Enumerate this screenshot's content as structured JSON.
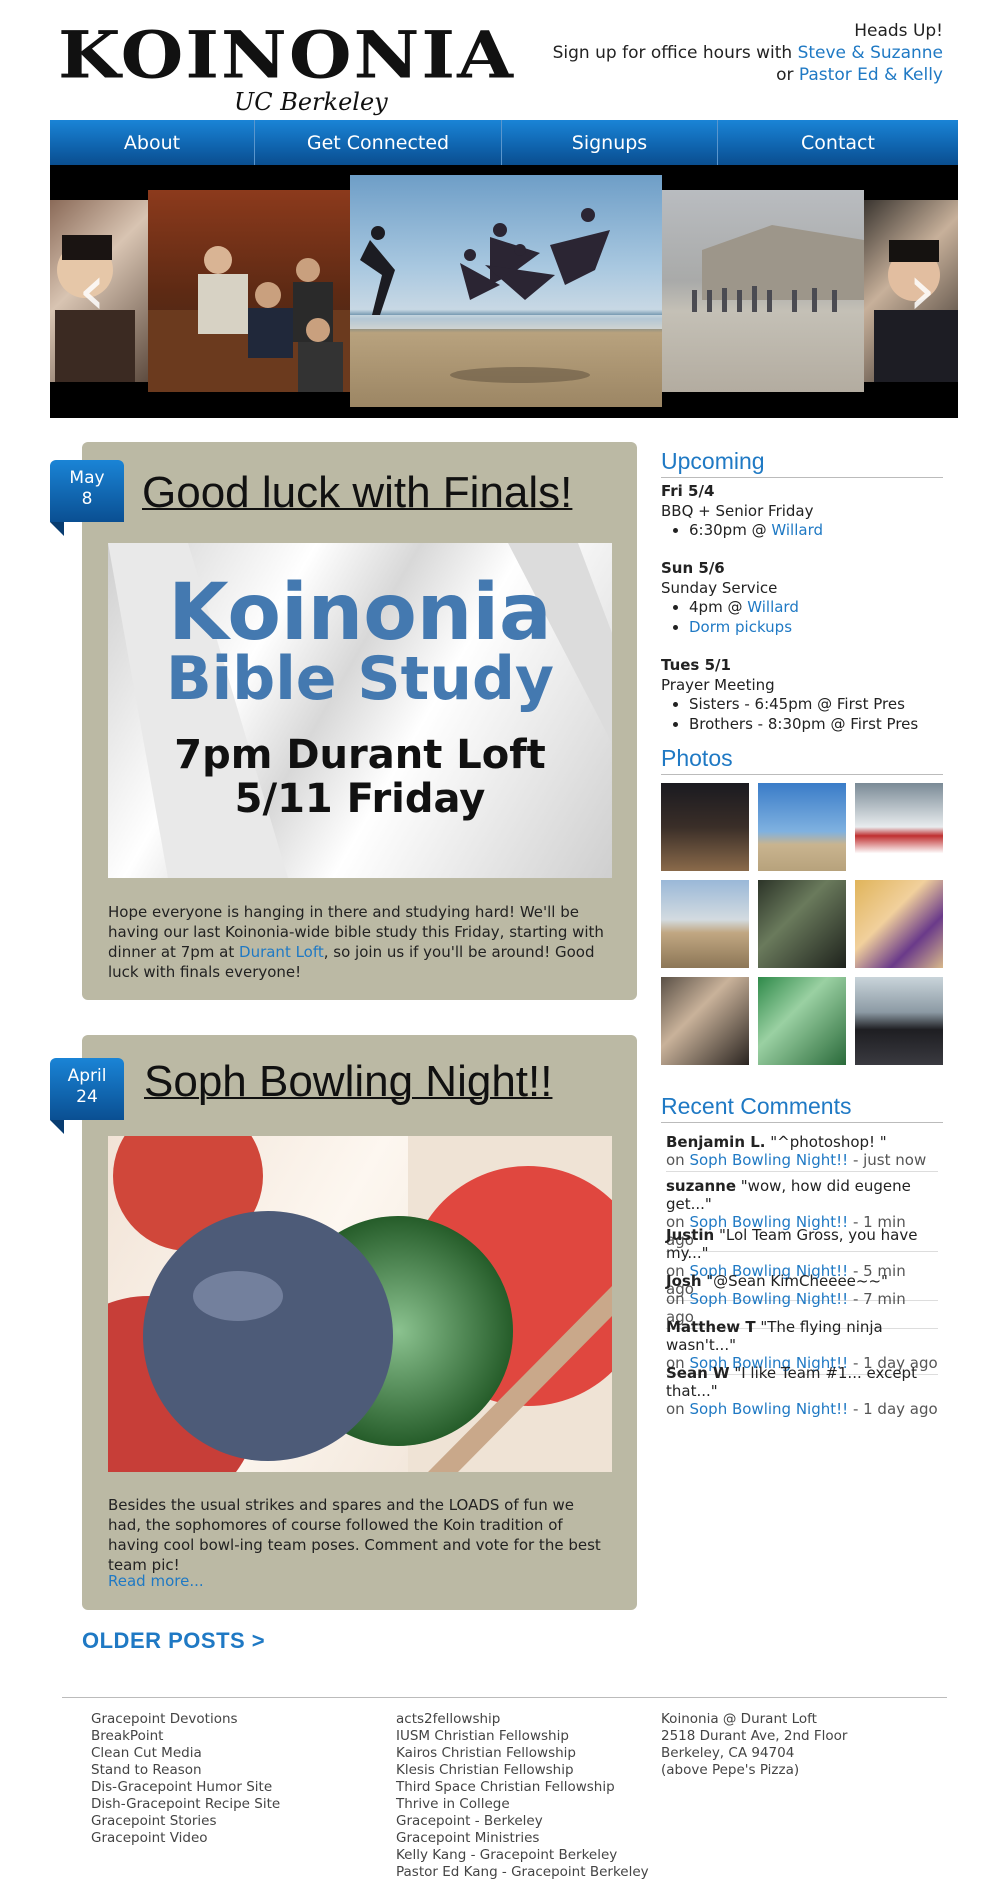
{
  "header": {
    "logo_main": "KOINONIA",
    "logo_sub": "UC Berkeley",
    "headsup_title": "Heads Up!",
    "headsup_line1_prefix": "Sign up for office hours with",
    "headsup_link1": "Steve & Suzanne",
    "headsup_line2_prefix": "or",
    "headsup_link2": "Pastor Ed & Kelly"
  },
  "nav": [
    "About",
    "Get Connected",
    "Signups",
    "Contact"
  ],
  "slider": {
    "prev": "‹",
    "next": "›"
  },
  "posts": [
    {
      "month": "May",
      "day": "8",
      "title": "Good luck with Finals!",
      "image_text": {
        "line1": "Koinonia",
        "line2": "Bible Study",
        "line3": "7pm Durant Loft",
        "line4": "5/11 Friday"
      },
      "body_before": "Hope everyone is hanging in there and studying hard! We'll be having our last Koinonia-wide bible study this Friday, starting with dinner at 7pm at",
      "body_link": "Durant Loft",
      "body_after": ", so join us if you'll be around! Good luck with finals everyone!"
    },
    {
      "month": "April",
      "day": "24",
      "title": "Soph Bowling Night!!",
      "body": "Besides the usual strikes and spares and the LOADS of fun we had, the sophomores of course followed the Koin tradition of having cool bowl-ing team poses. Comment and vote for the best team pic!",
      "read_more": "Read more..."
    }
  ],
  "sidebar": {
    "upcoming_title": "Upcoming",
    "events": [
      {
        "day": "Fri 5/4",
        "name": "BBQ + Senior Friday",
        "item1_text": "6:30pm @",
        "item1_link": "Willard"
      },
      {
        "day": "Sun 5/6",
        "name": "Sunday Service",
        "item1_text": "4pm @",
        "item1_link": "Willard",
        "item2_link": "Dorm pickups"
      },
      {
        "day": "Tues 5/1",
        "name": "Prayer Meeting",
        "item1_text": "Sisters - 6:45pm @ First Pres",
        "item2_text": "Brothers - 8:30pm @ First Pres"
      }
    ],
    "photos_title": "Photos",
    "comments_title": "Recent Comments",
    "comments": [
      {
        "who": "Benjamin L.",
        "text": "\"^photoshop!  \"",
        "on": "on",
        "post": "Soph Bowling Night!!",
        "time": "- just now"
      },
      {
        "who": "suzanne",
        "text": "\"wow, how did eugene get...\"",
        "on": "on",
        "post": "Soph Bowling Night!!",
        "time": "- 1 min ago"
      },
      {
        "who": "Justin",
        "text": "\"Lol Team Gross, you have my...\"",
        "on": "on",
        "post": "Soph Bowling Night!!",
        "time": "- 5 min ago"
      },
      {
        "who": "Josh",
        "text": "\"@Sean KimCheeee~~\"",
        "on": "on",
        "post": "Soph Bowling Night!!",
        "time": "- 7 min ago"
      },
      {
        "who": "Matthew T",
        "text": "\"The flying ninja wasn't...\"",
        "on": "on",
        "post": "Soph Bowling Night!!",
        "time": "- 1 day ago"
      },
      {
        "who": "Sean W",
        "text": "\"I like Team #1... except that...\"",
        "on": "on",
        "post": "Soph Bowling Night!!",
        "time": "- 1 day ago"
      }
    ]
  },
  "older_posts": "OLDER POSTS  >",
  "footer": {
    "col1": [
      "Gracepoint Devotions",
      "BreakPoint",
      "Clean Cut Media",
      "Stand to Reason",
      "Dis-Gracepoint Humor Site",
      "Dish-Gracepoint Recipe Site",
      "Gracepoint Stories",
      "Gracepoint Video"
    ],
    "col2": [
      "acts2fellowship",
      "IUSM Christian Fellowship",
      "Kairos Christian Fellowship",
      "Klesis Christian Fellowship",
      "Third Space Christian Fellowship",
      "Thrive in College",
      "Gracepoint - Berkeley",
      "Gracepoint Ministries",
      "Kelly Kang - Gracepoint Berkeley",
      "Pastor Ed Kang - Gracepoint Berkeley"
    ],
    "col3": [
      "Koinonia @ Durant Loft",
      "2518 Durant Ave, 2nd Floor",
      "Berkeley, CA 94704",
      "(above Pepe's Pizza)"
    ]
  },
  "colors": {
    "accent": "#1f79c4",
    "nav": "#0f63ad",
    "post_bg": "#bbb9a4"
  }
}
